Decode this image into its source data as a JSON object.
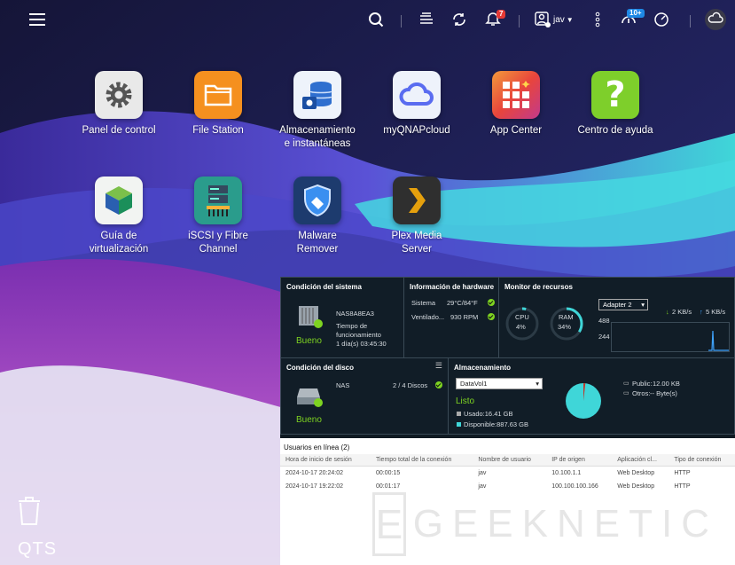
{
  "topbar": {
    "menu_icon": "hamburger-icon",
    "icons": [
      "search-icon",
      "tasks-icon",
      "sync-icon",
      "notification-bell-icon",
      "user-icon",
      "more-vertical-icon",
      "dashboard-speed-icon",
      "gauge-icon",
      "cloud-icon"
    ],
    "notification_count": "7",
    "event_count": "10+",
    "user": "jav",
    "colors": {
      "notification_badge": "#e53935",
      "event_badge": "#1e88e5"
    }
  },
  "apps": [
    {
      "label": "Panel de control",
      "icon": "gear-icon",
      "color": "#e9e9e9"
    },
    {
      "label": "File Station",
      "icon": "folder-icon",
      "color": "#f5901f"
    },
    {
      "label": "Almacenamiento\ne instantáneas",
      "icon": "storage-db-icon",
      "color": "#eef3fb"
    },
    {
      "label": "myQNAPcloud",
      "icon": "cloud-icon",
      "color": "#eef2fb"
    },
    {
      "label": "App Center",
      "icon": "app-grid-icon",
      "color": "#e8453c"
    },
    {
      "label": "Centro de ayuda",
      "icon": "question-icon",
      "color": "#7ecf2b"
    },
    {
      "label": "Guía de\nvirtualización",
      "icon": "virtualization-cube-icon",
      "color": "#f2f4f2"
    },
    {
      "label": "iSCSI y Fibre\nChannel",
      "icon": "server-rack-icon",
      "color": "#2a9c8c"
    },
    {
      "label": "Malware\nRemover",
      "icon": "shield-icon",
      "color": "#1d3b6e"
    },
    {
      "label": "Plex Media\nServer",
      "icon": "plex-chevron-icon",
      "color": "#2f2f2f"
    }
  ],
  "desktop": {
    "trash_icon": "trash-icon",
    "brand": "QTS"
  },
  "dashboard": {
    "system": {
      "title": "Condición del sistema",
      "nas_name": "NAS8A8EA3",
      "uptime_label": "Tiempo de\nfuncionamiento",
      "uptime": "1 día(s) 03:45:30",
      "status": "Bueno"
    },
    "hardware": {
      "title": "Información de hardware",
      "rows": [
        {
          "label": "Sistema",
          "value": "29°C/84°F"
        },
        {
          "label": "Ventilado...",
          "value": "930 RPM"
        }
      ]
    },
    "resources": {
      "title": "Monitor de recursos",
      "cpu_label": "CPU",
      "cpu_value": "4%",
      "cpu_pct": 4,
      "ram_label": "RAM",
      "ram_value": "34%",
      "ram_pct": 34,
      "adapter": "Adapter 2",
      "download": "2 KB/s",
      "upload": "5 KB/s",
      "y_top": "488",
      "y_mid": "244"
    },
    "disk": {
      "title": "Condición del disco",
      "name": "NAS",
      "disks": "2 / 4 Discos",
      "status": "Bueno"
    },
    "storage": {
      "title": "Almacenamiento",
      "volume": "DataVol1",
      "status": "Listo",
      "used": "Usado:16.41 GB",
      "free": "Disponible:887.63 GB",
      "shares": [
        {
          "name": "Public:",
          "value": "12.00 KB"
        },
        {
          "name": "Otros:",
          "value": "-- Byte(s)"
        }
      ],
      "used_pct": 1.8
    },
    "users": {
      "title": "Usuarios en línea (2)",
      "columns": [
        "Hora de inicio de sesión",
        "Tiempo total de la conexión",
        "Nombre de usuario",
        "IP de origen",
        "Aplicación cl...",
        "Tipo de conexión"
      ],
      "rows": [
        [
          "2024-10-17 20:24:02",
          "00:00:15",
          "jav",
          "10.100.1.1",
          "Web Desktop",
          "HTTP"
        ],
        [
          "2024-10-17 19:22:02",
          "00:01:17",
          "jav",
          "100.100.100.166",
          "Web Desktop",
          "HTTP"
        ]
      ]
    }
  },
  "watermark": {
    "letter": "E",
    "text": "GEEKNETIC"
  }
}
